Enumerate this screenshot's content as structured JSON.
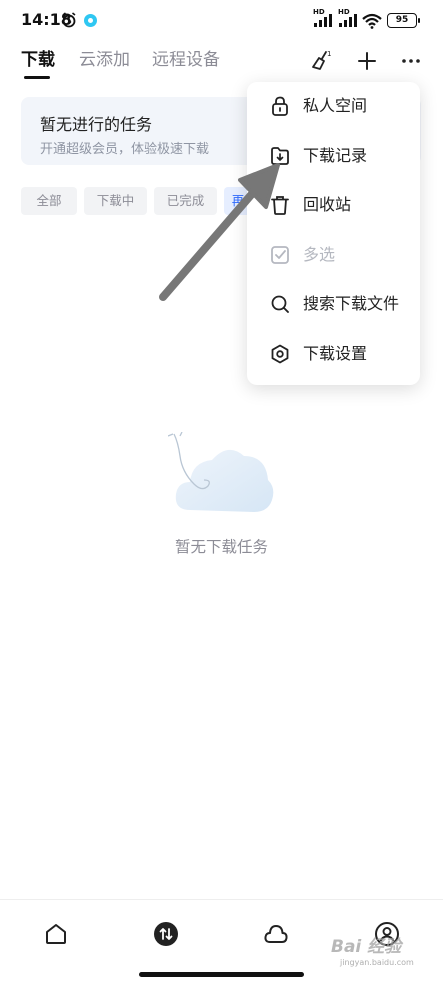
{
  "status_bar": {
    "time": "14:18",
    "network_label_1": "HD",
    "network_label_2": "HD",
    "battery": "95"
  },
  "header": {
    "tabs": [
      {
        "label": "下载",
        "active": true
      },
      {
        "label": "云添加",
        "active": false
      },
      {
        "label": "远程设备",
        "active": false
      }
    ],
    "notification_badge": "1",
    "icons": [
      "broom-icon",
      "plus-icon",
      "more-icon"
    ]
  },
  "banner": {
    "title": "暂无进行的任务",
    "subtitle": "开通超级会员，体验极速下载"
  },
  "filters": [
    {
      "label": "全部"
    },
    {
      "label": "下载中"
    },
    {
      "label": "已完成"
    },
    {
      "label": "再"
    }
  ],
  "empty_state": {
    "text": "暂无下载任务"
  },
  "menu": {
    "items": [
      {
        "label": "私人空间",
        "icon": "lock-icon",
        "enabled": true
      },
      {
        "label": "下载记录",
        "icon": "folder-download-icon",
        "enabled": true
      },
      {
        "label": "回收站",
        "icon": "trash-icon",
        "enabled": true
      },
      {
        "label": "多选",
        "icon": "checkbox-icon",
        "enabled": false
      },
      {
        "label": "搜索下载文件",
        "icon": "search-icon",
        "enabled": true
      },
      {
        "label": "下载设置",
        "icon": "settings-hexagon-icon",
        "enabled": true
      }
    ]
  },
  "bottom_nav": {
    "items": [
      "home-icon",
      "transfer-icon",
      "cloud-icon",
      "profile-icon"
    ]
  },
  "watermark": {
    "text": "Bai 经验",
    "url": "jingyan.baidu.com"
  },
  "colors": {
    "accent": "#2f6bff",
    "muted_text": "#8c8c96",
    "banner_bg": "#f2f5fa",
    "arrow": "#777777"
  }
}
